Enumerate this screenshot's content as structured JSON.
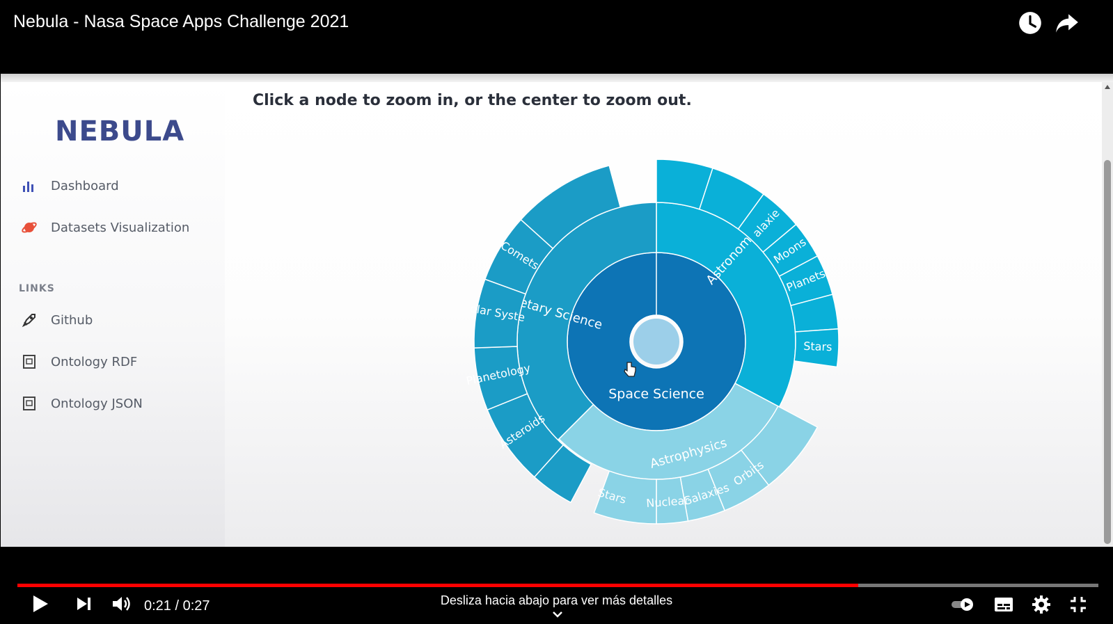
{
  "video": {
    "title": "Nebula - Nasa Space Apps Challenge 2021"
  },
  "app": {
    "logo": "NEBULA",
    "nav": [
      {
        "label": "Dashboard",
        "icon": "bar-chart-icon"
      },
      {
        "label": "Datasets Visualization",
        "icon": "planet-icon"
      }
    ],
    "links_heading": "LINKS",
    "links": [
      {
        "label": "Github",
        "icon": "rocket-icon"
      },
      {
        "label": "Ontology RDF",
        "icon": "document-icon"
      },
      {
        "label": "Ontology JSON",
        "icon": "document-icon"
      }
    ],
    "instruction": "Click a node to zoom in, or the center to zoom out.",
    "sunburst": {
      "root": "Space Science",
      "children": [
        {
          "name": "Astronomy",
          "children": [
            "alaxie",
            "Moons",
            "Planets",
            "Stars"
          ]
        },
        {
          "name": "Astrophysics",
          "children": [
            "Stars",
            "Nuclear",
            "Galaxies",
            "Orbits"
          ]
        },
        {
          "name": "Planetary Science",
          "children": [
            "Asteroids",
            "Planetology",
            "olar Syste",
            "Comets"
          ]
        }
      ],
      "colors": {
        "root": "#0d74b5",
        "center": "#9ccfe9",
        "astronomy": "#0ab0d8",
        "astrophysics": "#8ad3e6",
        "planetary": "#1b9cc6"
      }
    }
  },
  "player": {
    "current_time": "0:21",
    "duration": "0:27",
    "progress_fraction": 0.7778,
    "swipe_hint": "Desliza hacia abajo para ver más detalles",
    "progress_color": "#ff0000"
  }
}
